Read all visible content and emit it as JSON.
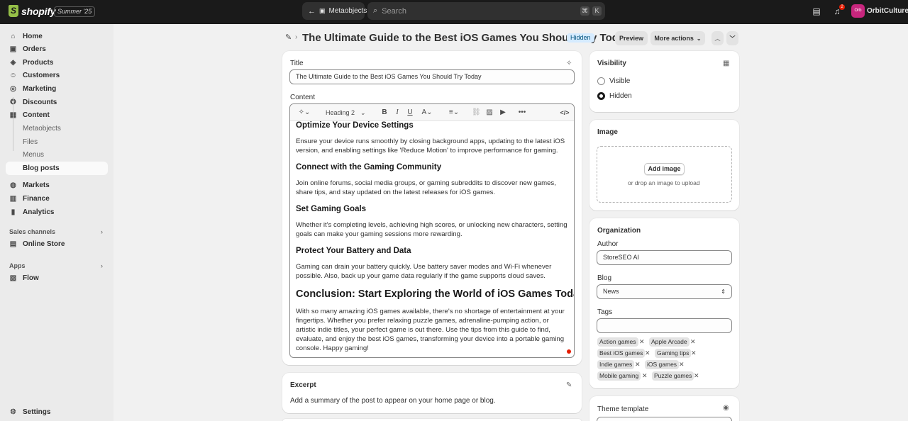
{
  "topbar": {
    "brand": "shopify",
    "edition": "Summer '25",
    "back_label": "Metaobjects",
    "search_placeholder": "Search",
    "search_kbd_1": "⌘",
    "search_kbd_2": "K",
    "notification_count": "2",
    "avatar_initials": "Orb",
    "store_name": "OrbitCulture"
  },
  "sidebar": {
    "items": [
      {
        "label": "Home"
      },
      {
        "label": "Orders"
      },
      {
        "label": "Products"
      },
      {
        "label": "Customers"
      },
      {
        "label": "Marketing"
      },
      {
        "label": "Discounts"
      },
      {
        "label": "Content"
      }
    ],
    "content_sub": [
      {
        "label": "Metaobjects"
      },
      {
        "label": "Files"
      },
      {
        "label": "Menus"
      },
      {
        "label": "Blog posts"
      }
    ],
    "items2": [
      {
        "label": "Markets"
      },
      {
        "label": "Finance"
      },
      {
        "label": "Analytics"
      }
    ],
    "sales_channels_label": "Sales channels",
    "online_store": "Online Store",
    "apps_label": "Apps",
    "flow": "Flow",
    "settings": "Settings"
  },
  "header": {
    "title": "The Ultimate Guide to the Best iOS Games You Should Try Today",
    "status_badge": "Hidden",
    "preview": "Preview",
    "more_actions": "More actions"
  },
  "post": {
    "title_label": "Title",
    "title_value": "The Ultimate Guide to the Best iOS Games You Should Try Today",
    "content_label": "Content",
    "heading_select": "Heading 2",
    "content": {
      "h_device": "Optimize Your Device Settings",
      "p_device": "Ensure your device runs smoothly by closing background apps, updating to the latest iOS version, and enabling settings like 'Reduce Motion' to improve performance for gaming.",
      "h_community": "Connect with the Gaming Community",
      "p_community": "Join online forums, social media groups, or gaming subreddits to discover new games, share tips, and stay updated on the latest releases for iOS games.",
      "h_goals": "Set Gaming Goals",
      "p_goals": "Whether it's completing levels, achieving high scores, or unlocking new characters, setting goals can make your gaming sessions more rewarding.",
      "h_battery": "Protect Your Battery and Data",
      "p_battery": "Gaming can drain your battery quickly. Use battery saver modes and Wi-Fi whenever possible. Also, back up your game data regularly if the game supports cloud saves.",
      "h_conclusion": "Conclusion: Start Exploring the World of iOS Games Today",
      "p_conclusion": "With so many amazing iOS games available, there's no shortage of entertainment at your fingertips. Whether you prefer relaxing puzzle games, adrenaline-pumping action, or artistic indie titles, your perfect game is out there. Use the tips from this guide to find, evaluate, and enjoy the best iOS games, transforming your device into a portable gaming console. Happy gaming!"
    },
    "excerpt_label": "Excerpt",
    "excerpt_hint": "Add a summary of the post to appear on your home page or blog."
  },
  "visibility": {
    "label": "Visibility",
    "visible": "Visible",
    "hidden": "Hidden",
    "selected": "hidden"
  },
  "image": {
    "label": "Image",
    "add_button": "Add image",
    "hint": "or drop an image to upload"
  },
  "organization": {
    "label": "Organization",
    "author_label": "Author",
    "author_value": "StoreSEO AI",
    "blog_label": "Blog",
    "blog_value": "News",
    "tags_label": "Tags",
    "tags": [
      "Action games",
      "Apple Arcade",
      "Best iOS games",
      "Gaming tips",
      "Indie games",
      "iOS games",
      "Mobile gaming",
      "Puzzle games"
    ]
  },
  "theme": {
    "label": "Theme template"
  }
}
